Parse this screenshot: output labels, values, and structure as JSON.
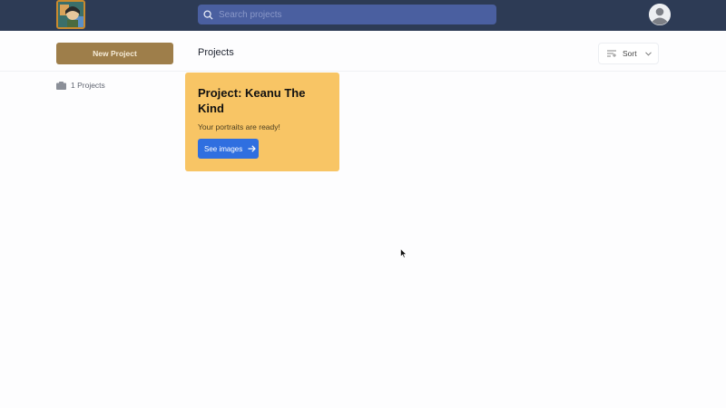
{
  "header": {
    "search": {
      "placeholder": "Search projects",
      "value": ""
    }
  },
  "sidebar": {
    "new_project_label": "New Project",
    "project_count": "1 Projects"
  },
  "main": {
    "title": "Projects",
    "sort_label": "Sort",
    "cards": [
      {
        "title": "Project: Keanu The Kind",
        "subtitle": "Your portraits are ready!",
        "button_label": "See images"
      }
    ]
  },
  "colors": {
    "topbar": "#2d3b55",
    "search": "#4a5fa0",
    "new_project": "#9e7e4a",
    "card": "#f8c565",
    "primary_button": "#2f6fe0"
  },
  "icons": [
    "search-icon",
    "user-avatar-icon",
    "folder-icon",
    "sort-icon",
    "chevron-down-icon",
    "arrow-right-icon"
  ]
}
